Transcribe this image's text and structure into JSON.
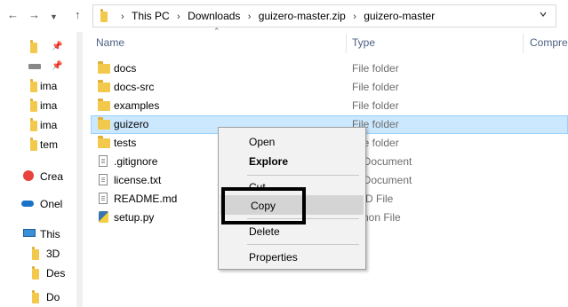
{
  "address": {
    "crumbs": [
      "This PC",
      "Downloads",
      "guizero-master.zip",
      "guizero-master"
    ]
  },
  "columns": {
    "name": "Name",
    "type": "Type",
    "compressed": "Compre"
  },
  "sidebar": {
    "items": [
      {
        "label": "",
        "icon": "folder-icon"
      },
      {
        "label": "",
        "icon": "drive-icon"
      },
      {
        "label": "ima",
        "icon": "folder-icon"
      },
      {
        "label": "ima",
        "icon": "folder-icon"
      },
      {
        "label": "ima",
        "icon": "folder-icon"
      },
      {
        "label": "tem",
        "icon": "folder-icon"
      },
      {
        "label": "Crea",
        "icon": "creative-cloud-icon"
      },
      {
        "label": "Onel",
        "icon": "onedrive-icon"
      },
      {
        "label": "This",
        "icon": "this-pc-icon"
      },
      {
        "label": "3D",
        "icon": "folder-3d-icon"
      },
      {
        "label": "Des",
        "icon": "desktop-folder-icon"
      },
      {
        "label": "Do",
        "icon": "documents-folder-icon"
      }
    ]
  },
  "files": [
    {
      "name": "docs",
      "type": "File folder",
      "icon": "folder-icon"
    },
    {
      "name": "docs-src",
      "type": "File folder",
      "icon": "folder-icon"
    },
    {
      "name": "examples",
      "type": "File folder",
      "icon": "folder-icon"
    },
    {
      "name": "guizero",
      "type": "File folder",
      "icon": "folder-icon",
      "selected": true
    },
    {
      "name": "tests",
      "type": "File folder",
      "icon": "folder-icon"
    },
    {
      "name": ".gitignore",
      "type": "t Document",
      "icon": "text-file-icon"
    },
    {
      "name": "license.txt",
      "type": "t Document",
      "icon": "text-file-icon"
    },
    {
      "name": "README.md",
      "type": "D File",
      "icon": "text-file-icon"
    },
    {
      "name": "setup.py",
      "type": "hon File",
      "icon": "python-file-icon"
    }
  ],
  "context_menu": {
    "items": [
      "Open",
      "Explore",
      "Cut",
      "Copy",
      "Delete",
      "Properties"
    ]
  },
  "colors": {
    "selection_bg": "#cce8ff",
    "selection_border": "#99d1ff",
    "menu_bg": "#f2f2f2",
    "menu_hover": "#d4d4d4",
    "header_text": "#4d6082",
    "annotation_box": "#000000"
  }
}
